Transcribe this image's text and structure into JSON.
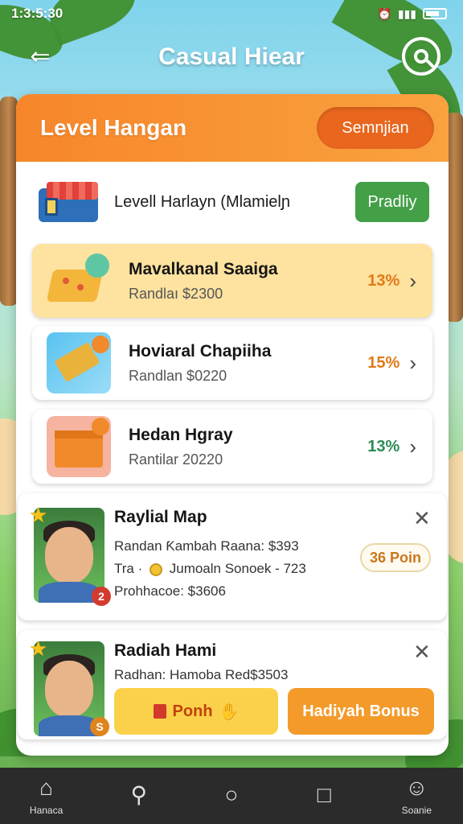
{
  "status_bar": {
    "time": "1:3:5:30"
  },
  "header": {
    "title": "Casual Hiear"
  },
  "panel": {
    "title": "Level Hangan",
    "header_button": "Semnjian",
    "summary": {
      "text": "Levell Harlayn (Mlamielɲ",
      "button": "Pradliy"
    }
  },
  "items": [
    {
      "title": "Mavalkanal Saaiga",
      "subtitle": "Randlaı $2300",
      "percent": "13%",
      "percent_color": "#e07b17"
    },
    {
      "title": "Hoviaral Chapiiha",
      "subtitle": "Randlan $0220",
      "percent": "15%",
      "percent_color": "#e07b17"
    },
    {
      "title": "Hedan Hgray",
      "subtitle": "Rantilar 20220",
      "percent": "13%",
      "percent_color": "#2e8b57"
    }
  ],
  "person1": {
    "name": "Raylial Map",
    "line1": "Randan Ƙambah Raana: $393",
    "line2_prefix": "Tra ·",
    "line2_suffix": "Jumoaln Sonoek - 723",
    "line3": "Prohhacoe: $3606",
    "badge": "2",
    "points": "36 Poin"
  },
  "person2": {
    "name": "Radiah Hami",
    "line1": "Radhan: Hamoba Red$3503",
    "badge": "S"
  },
  "actions": {
    "primary": "Ponh",
    "secondary": "Hadiyah Bonus"
  },
  "nav": [
    {
      "label": "Hanaca",
      "icon": "home-icon"
    },
    {
      "label": "",
      "icon": "search-icon"
    },
    {
      "label": "",
      "icon": "circle-icon"
    },
    {
      "label": "",
      "icon": "square-icon"
    },
    {
      "label": "Soanie",
      "icon": "profile-icon"
    }
  ]
}
